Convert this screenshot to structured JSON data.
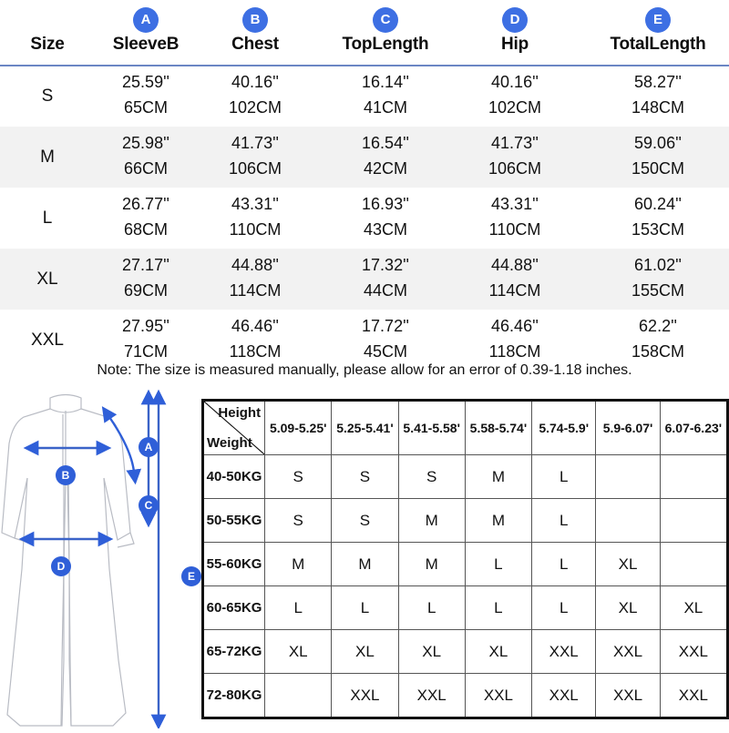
{
  "size_table": {
    "columns": [
      {
        "badge": "",
        "label": "Size"
      },
      {
        "badge": "A",
        "label": "SleeveB"
      },
      {
        "badge": "B",
        "label": "Chest"
      },
      {
        "badge": "C",
        "label": "TopLength"
      },
      {
        "badge": "D",
        "label": "Hip"
      },
      {
        "badge": "E",
        "label": "TotalLength"
      }
    ],
    "rows": [
      {
        "size": "S",
        "inches": [
          "25.59''",
          "40.16''",
          "16.14''",
          "40.16''",
          "58.27''"
        ],
        "cm": [
          "65CM",
          "102CM",
          "41CM",
          "102CM",
          "148CM"
        ]
      },
      {
        "size": "M",
        "inches": [
          "25.98''",
          "41.73''",
          "16.54''",
          "41.73''",
          "59.06''"
        ],
        "cm": [
          "66CM",
          "106CM",
          "42CM",
          "106CM",
          "150CM"
        ]
      },
      {
        "size": "L",
        "inches": [
          "26.77''",
          "43.31''",
          "16.93''",
          "43.31''",
          "60.24''"
        ],
        "cm": [
          "68CM",
          "110CM",
          "43CM",
          "110CM",
          "153CM"
        ]
      },
      {
        "size": "XL",
        "inches": [
          "27.17''",
          "44.88''",
          "17.32''",
          "44.88''",
          "61.02''"
        ],
        "cm": [
          "69CM",
          "114CM",
          "44CM",
          "114CM",
          "155CM"
        ]
      },
      {
        "size": "XXL",
        "inches": [
          "27.95''",
          "46.46''",
          "17.72''",
          "46.46''",
          "62.2''"
        ],
        "cm": [
          "71CM",
          "118CM",
          "45CM",
          "118CM",
          "158CM"
        ]
      }
    ],
    "note": "Note: The size is measured manually, please allow for an error of 0.39-1.18 inches."
  },
  "figure": {
    "badges": [
      "A",
      "B",
      "C",
      "D",
      "E"
    ]
  },
  "hw_table": {
    "corner": {
      "height_label": "Height",
      "weight_label": "Weight"
    },
    "height_headers": [
      "5.09-5.25'",
      "5.25-5.41'",
      "5.41-5.58'",
      "5.58-5.74'",
      "5.74-5.9'",
      "5.9-6.07'",
      "6.07-6.23'"
    ],
    "weight_labels": [
      "40-50KG",
      "50-55KG",
      "55-60KG",
      "60-65KG",
      "65-72KG",
      "72-80KG"
    ],
    "cells": [
      [
        "S",
        "S",
        "S",
        "M",
        "L",
        "",
        ""
      ],
      [
        "S",
        "S",
        "M",
        "M",
        "L",
        "",
        ""
      ],
      [
        "M",
        "M",
        "M",
        "L",
        "L",
        "XL",
        ""
      ],
      [
        "L",
        "L",
        "L",
        "L",
        "L",
        "XL",
        "XL"
      ],
      [
        "XL",
        "XL",
        "XL",
        "XL",
        "XXL",
        "XXL",
        "XXL"
      ],
      [
        "",
        "XXL",
        "XXL",
        "XXL",
        "XXL",
        "XXL",
        "XXL"
      ]
    ]
  },
  "colors": {
    "badge_blue": "#3d6fe3",
    "divider_blue": "#6b86c4",
    "stripe_gray": "#f2f2f2",
    "arrow_blue": "#2f5fd8",
    "garment_outline": "#b9bcc4"
  }
}
